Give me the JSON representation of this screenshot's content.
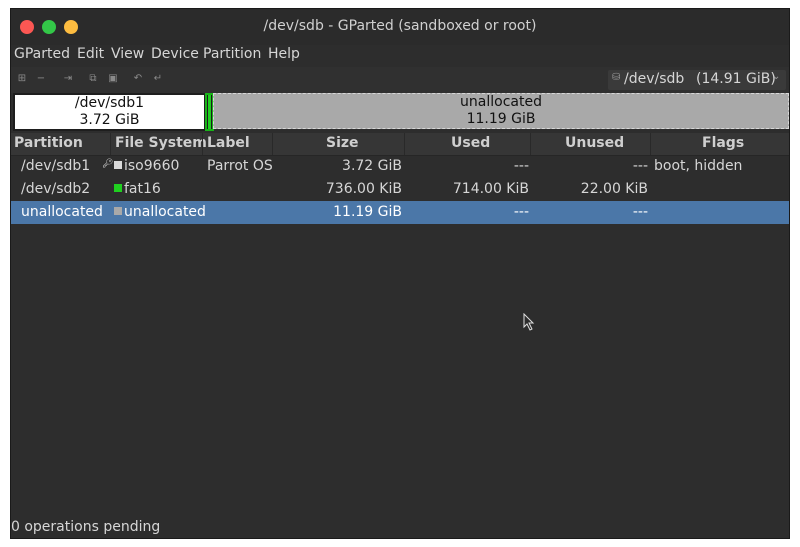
{
  "window": {
    "title": "/dev/sdb - GParted (sandboxed or root)"
  },
  "menu": [
    "GParted",
    "Edit",
    "View",
    "Device",
    "Partition",
    "Help"
  ],
  "toolbar": {
    "icons": [
      "new-icon",
      "delete-icon",
      "resize-move-icon",
      "copy-icon",
      "paste-icon",
      "undo-icon",
      "apply-icon"
    ]
  },
  "device_selector": {
    "name": "/dev/sdb",
    "size": "(14.91 GiB)"
  },
  "disk_map": [
    {
      "name": "/dev/sdb1",
      "size": "3.72 GiB",
      "fill": "#ffffff"
    },
    {
      "name": "",
      "size": "",
      "fill": "#1fd01f"
    },
    {
      "name": "unallocated",
      "size": "11.19 GiB",
      "fill": "#a9a9a9"
    }
  ],
  "table": {
    "columns": [
      "Partition",
      "File System",
      "Label",
      "Size",
      "Used",
      "Unused",
      "Flags"
    ],
    "rows": [
      {
        "partition": "/dev/sdb1",
        "fs": "iso9660",
        "fs_color": "#d9d9d9",
        "label": "Parrot OS",
        "size": "3.72 GiB",
        "used": "---",
        "unused": "---",
        "flags": "boot, hidden",
        "mounted": true
      },
      {
        "partition": "/dev/sdb2",
        "fs": "fat16",
        "fs_color": "#1fd01f",
        "label": "",
        "size": "736.00 KiB",
        "used": "714.00 KiB",
        "unused": "22.00 KiB",
        "flags": "",
        "mounted": false
      },
      {
        "partition": "unallocated",
        "fs": "unallocated",
        "fs_color": "#a9a9a9",
        "label": "",
        "size": "11.19 GiB",
        "used": "---",
        "unused": "---",
        "flags": "",
        "mounted": false,
        "selected": true
      }
    ]
  },
  "status": {
    "text": "0 operations pending"
  },
  "colors": {
    "selection": "#4b77a8",
    "background": "#2d2d2d"
  }
}
